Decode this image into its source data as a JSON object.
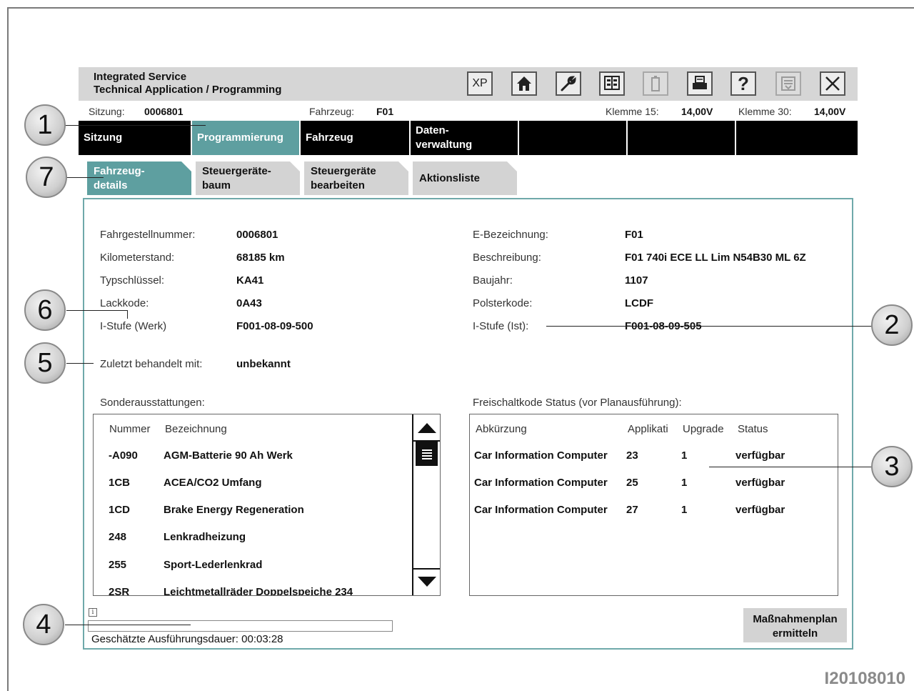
{
  "header": {
    "title_line1": "Integrated Service",
    "title_line2": "Technical Application / Programming",
    "xp_label": "XP",
    "help_label": "?",
    "tools": [
      "xp-icon",
      "home-icon",
      "wrench-icon",
      "ecu-icon",
      "battery-icon",
      "print-icon",
      "help-icon",
      "list-icon",
      "close-icon"
    ]
  },
  "status": {
    "sitzung_label": "Sitzung:",
    "sitzung_value": "0006801",
    "fahrzeug_label": "Fahrzeug:",
    "fahrzeug_value": "F01",
    "klemme15_label": "Klemme 15:",
    "klemme15_value": "14,00V",
    "klemme30_label": "Klemme 30:",
    "klemme30_value": "14,00V"
  },
  "mainnav": {
    "items": [
      {
        "label": "Sitzung",
        "active": false
      },
      {
        "label": "Programmierung",
        "active": true
      },
      {
        "label": "Fahrzeug",
        "active": false
      },
      {
        "label_line1": "Daten-",
        "label_line2": "verwaltung",
        "active": false
      }
    ]
  },
  "subtabs": [
    {
      "line1": "Fahrzeug-",
      "line2": "details",
      "active": true
    },
    {
      "line1": "Steuergeräte-",
      "line2": "baum",
      "active": false
    },
    {
      "line1": "Steuergeräte",
      "line2": "bearbeiten",
      "active": false
    },
    {
      "line1": "Aktionsliste",
      "line2": "",
      "active": false
    }
  ],
  "details": {
    "left": [
      {
        "label": "Fahrgestellnummer:",
        "value": "0006801"
      },
      {
        "label": "Kilometerstand:",
        "value": "68185 km"
      },
      {
        "label": "Typschlüssel:",
        "value": "KA41"
      },
      {
        "label": "Lackkode:",
        "value": "0A43"
      },
      {
        "label": "I-Stufe (Werk)",
        "value": "F001-08-09-500"
      }
    ],
    "right": [
      {
        "label": "E-Bezeichnung:",
        "value": "F01"
      },
      {
        "label": "Beschreibung:",
        "value": "F01 740i ECE LL Lim N54B30 ML 6Z"
      },
      {
        "label": "Baujahr:",
        "value": "1107"
      },
      {
        "label": "Polsterkode:",
        "value": "LCDF"
      },
      {
        "label": "I-Stufe (Ist):",
        "value": "F001-08-09-505"
      }
    ],
    "last_treated_label": "Zuletzt behandelt mit:",
    "last_treated_value": "unbekannt"
  },
  "sonderausstattungen": {
    "title": "Sonderausstattungen:",
    "col_nummer": "Nummer",
    "col_bezeichnung": "Bezeichnung",
    "rows": [
      {
        "nummer": "-A090",
        "bezeichnung": "AGM-Batterie 90 Ah Werk"
      },
      {
        "nummer": "1CB",
        "bezeichnung": "ACEA/CO2 Umfang"
      },
      {
        "nummer": "1CD",
        "bezeichnung": "Brake Energy Regeneration"
      },
      {
        "nummer": "248",
        "bezeichnung": "Lenkradheizung"
      },
      {
        "nummer": "255",
        "bezeichnung": "Sport-Lederlenkrad"
      },
      {
        "nummer": "2SR",
        "bezeichnung": "Leichtmetallräder Doppelspeiche 234"
      }
    ]
  },
  "freischaltkode": {
    "title": "Freischaltkode Status (vor Planausführung):",
    "col_abk": "Abkürzung",
    "col_app": "Applikati",
    "col_upg": "Upgrade",
    "col_status": "Status",
    "rows": [
      {
        "abk": "Car Information Computer",
        "app": "23",
        "upg": "1",
        "status": "verfügbar"
      },
      {
        "abk": "Car Information Computer",
        "app": "25",
        "upg": "1",
        "status": "verfügbar"
      },
      {
        "abk": "Car Information Computer",
        "app": "27",
        "upg": "1",
        "status": "verfügbar"
      }
    ]
  },
  "footer": {
    "info_icon": "i",
    "progress_fraction": 0,
    "duration": "Geschätzte Ausführungsdauer: 00:03:28",
    "action_line1": "Maßnahmenplan",
    "action_line2": "ermitteln"
  },
  "callouts": [
    "1",
    "2",
    "3",
    "4",
    "5",
    "6",
    "7"
  ],
  "image_code": "I20108010"
}
